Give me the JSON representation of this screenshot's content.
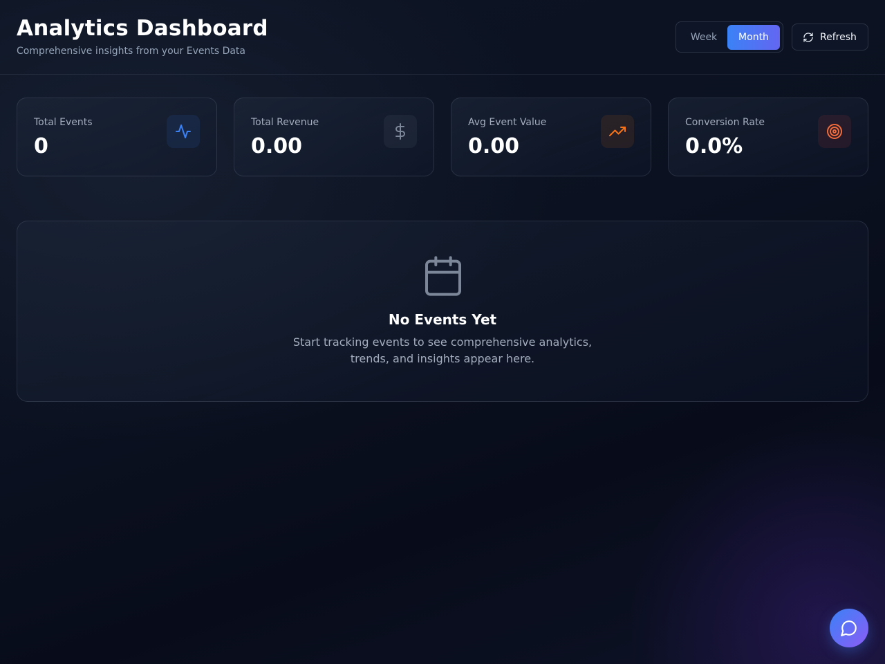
{
  "header": {
    "title": "Analytics Dashboard",
    "subtitle": "Comprehensive insights from your Events Data"
  },
  "range_toggle": {
    "options": [
      "Week",
      "Month"
    ],
    "selected": "Month"
  },
  "refresh": {
    "label": "Refresh",
    "icon": "refresh-icon"
  },
  "stats": [
    {
      "label": "Total Events",
      "value": "0",
      "icon": "activity-icon",
      "icon_color": "#3b82f6"
    },
    {
      "label": "Total Revenue",
      "value": "0.00",
      "icon": "dollar-icon",
      "icon_color": "#94a3b8"
    },
    {
      "label": "Avg Event Value",
      "value": "0.00",
      "icon": "trending-up-icon",
      "icon_color": "#f97316"
    },
    {
      "label": "Conversion Rate",
      "value": "0.0%",
      "icon": "target-icon",
      "icon_color": "#f97316"
    }
  ],
  "empty_state": {
    "icon": "calendar-icon",
    "title": "No Events Yet",
    "description": "Start tracking events to see comprehensive analytics, trends, and insights appear here."
  },
  "chat_button": {
    "icon": "chat-icon"
  },
  "colors": {
    "accent_blue": "#3b82f6",
    "accent_indigo": "#6366f1",
    "accent_orange": "#f97316",
    "background": "#0b1120"
  }
}
